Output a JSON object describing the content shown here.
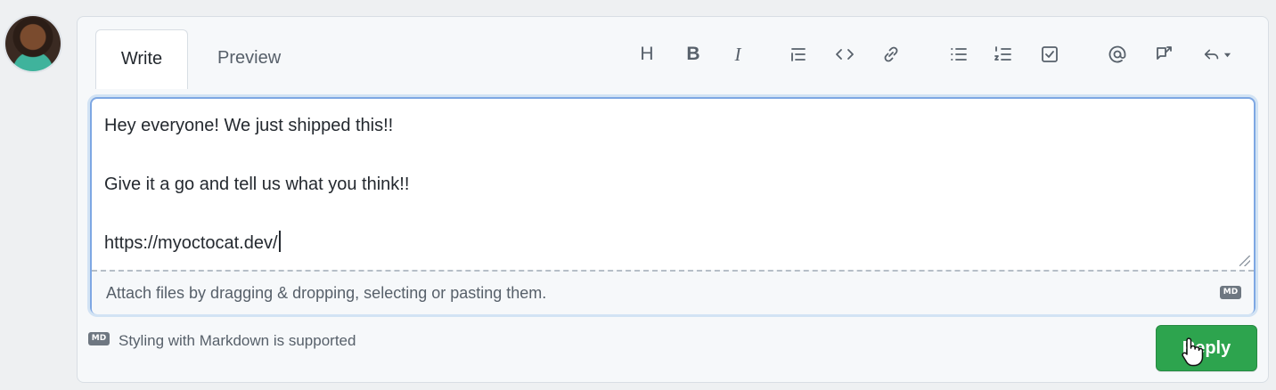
{
  "tabs": {
    "write": "Write",
    "preview": "Preview"
  },
  "toolbar": {
    "items": [
      {
        "icon": "heading-icon",
        "glyph": "H"
      },
      {
        "icon": "bold-icon",
        "glyph": "B"
      },
      {
        "icon": "italic-icon",
        "glyph": "I"
      },
      {
        "icon": "quote-icon"
      },
      {
        "icon": "code-icon",
        "glyph": "<>"
      },
      {
        "icon": "link-icon"
      },
      {
        "icon": "unordered-list-icon"
      },
      {
        "icon": "ordered-list-icon"
      },
      {
        "icon": "task-list-icon"
      },
      {
        "icon": "mention-icon",
        "glyph": "@"
      },
      {
        "icon": "reference-icon"
      },
      {
        "icon": "reply-arrow-icon"
      }
    ]
  },
  "editor": {
    "lines": [
      "Hey everyone!  We just shipped this!!",
      "Give it a go and tell us what you think!!",
      "https://myoctocat.dev/"
    ]
  },
  "attach": {
    "text": "Attach files by dragging & dropping, selecting or pasting them."
  },
  "footer": {
    "markdown_text": "Styling with Markdown is supported",
    "md_badge": "MD"
  },
  "actions": {
    "reply_label": "Reply"
  },
  "colors": {
    "primary": "#2da44e",
    "focus": "#7ea7e3"
  }
}
